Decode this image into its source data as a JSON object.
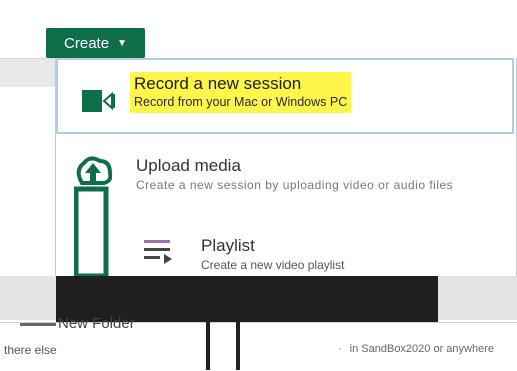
{
  "create_button": {
    "label": "Create",
    "caret": "▼"
  },
  "menu": {
    "items": [
      {
        "title": "Record a new session",
        "subtitle": "Record from your Mac or Windows PC",
        "icon": "video-camera-icon"
      },
      {
        "title": "Upload media",
        "subtitle": "Create a new session by uploading video or audio files",
        "icon": "upload-cloud-icon"
      },
      {
        "title": "Playlist",
        "subtitle": "Create a new video playlist",
        "icon": "playlist-icon"
      }
    ]
  },
  "background": {
    "new_folder": "New Folder",
    "footer_left": "there else",
    "footer_right": "in SandBox2020 or anywhere"
  },
  "colors": {
    "create_bg": "#0e6e4a",
    "highlight": "#fff64b",
    "selection_border": "#aecde6",
    "icon_green": "#0e6e4a"
  }
}
